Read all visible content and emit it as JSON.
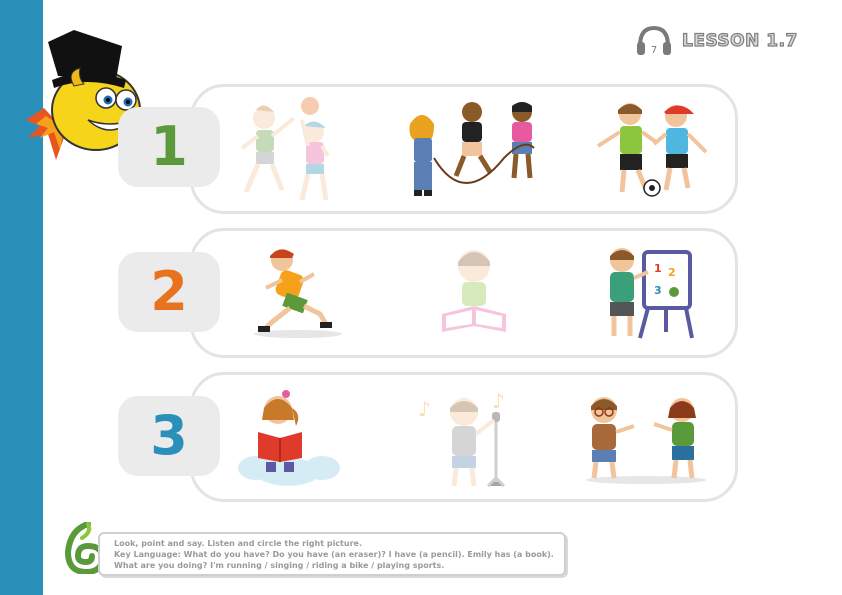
{
  "header": {
    "lesson_title": "LESSON 1.7",
    "audio_track_number": "7"
  },
  "rows": [
    {
      "number": "1",
      "number_color": "#5a9a3a",
      "pictures": [
        "children-playing-volleyball",
        "children-jumping-rope",
        "boys-playing-football"
      ]
    },
    {
      "number": "2",
      "number_color": "#e8731f",
      "pictures": [
        "boy-running",
        "boy-reading-book",
        "boy-at-easel-board"
      ]
    },
    {
      "number": "3",
      "number_color": "#2a8fb9",
      "pictures": [
        "girl-reading-on-cloud",
        "boy-singing-microphone",
        "boy-and-girl-talking"
      ]
    }
  ],
  "instructions": {
    "line1": "Look, point and say. Listen and circle the right picture.",
    "line2": "Key Language:  What do you have? Do you have (an eraser)? I have (a pencil). Emily has (a book).",
    "line3": "What are you doing? I'm  running / singing / riding a bike / playing sports."
  },
  "colors": {
    "side_bar": "#2a8fb9",
    "panel_border": "#e3e3e3",
    "number_box": "#ebebeb"
  }
}
